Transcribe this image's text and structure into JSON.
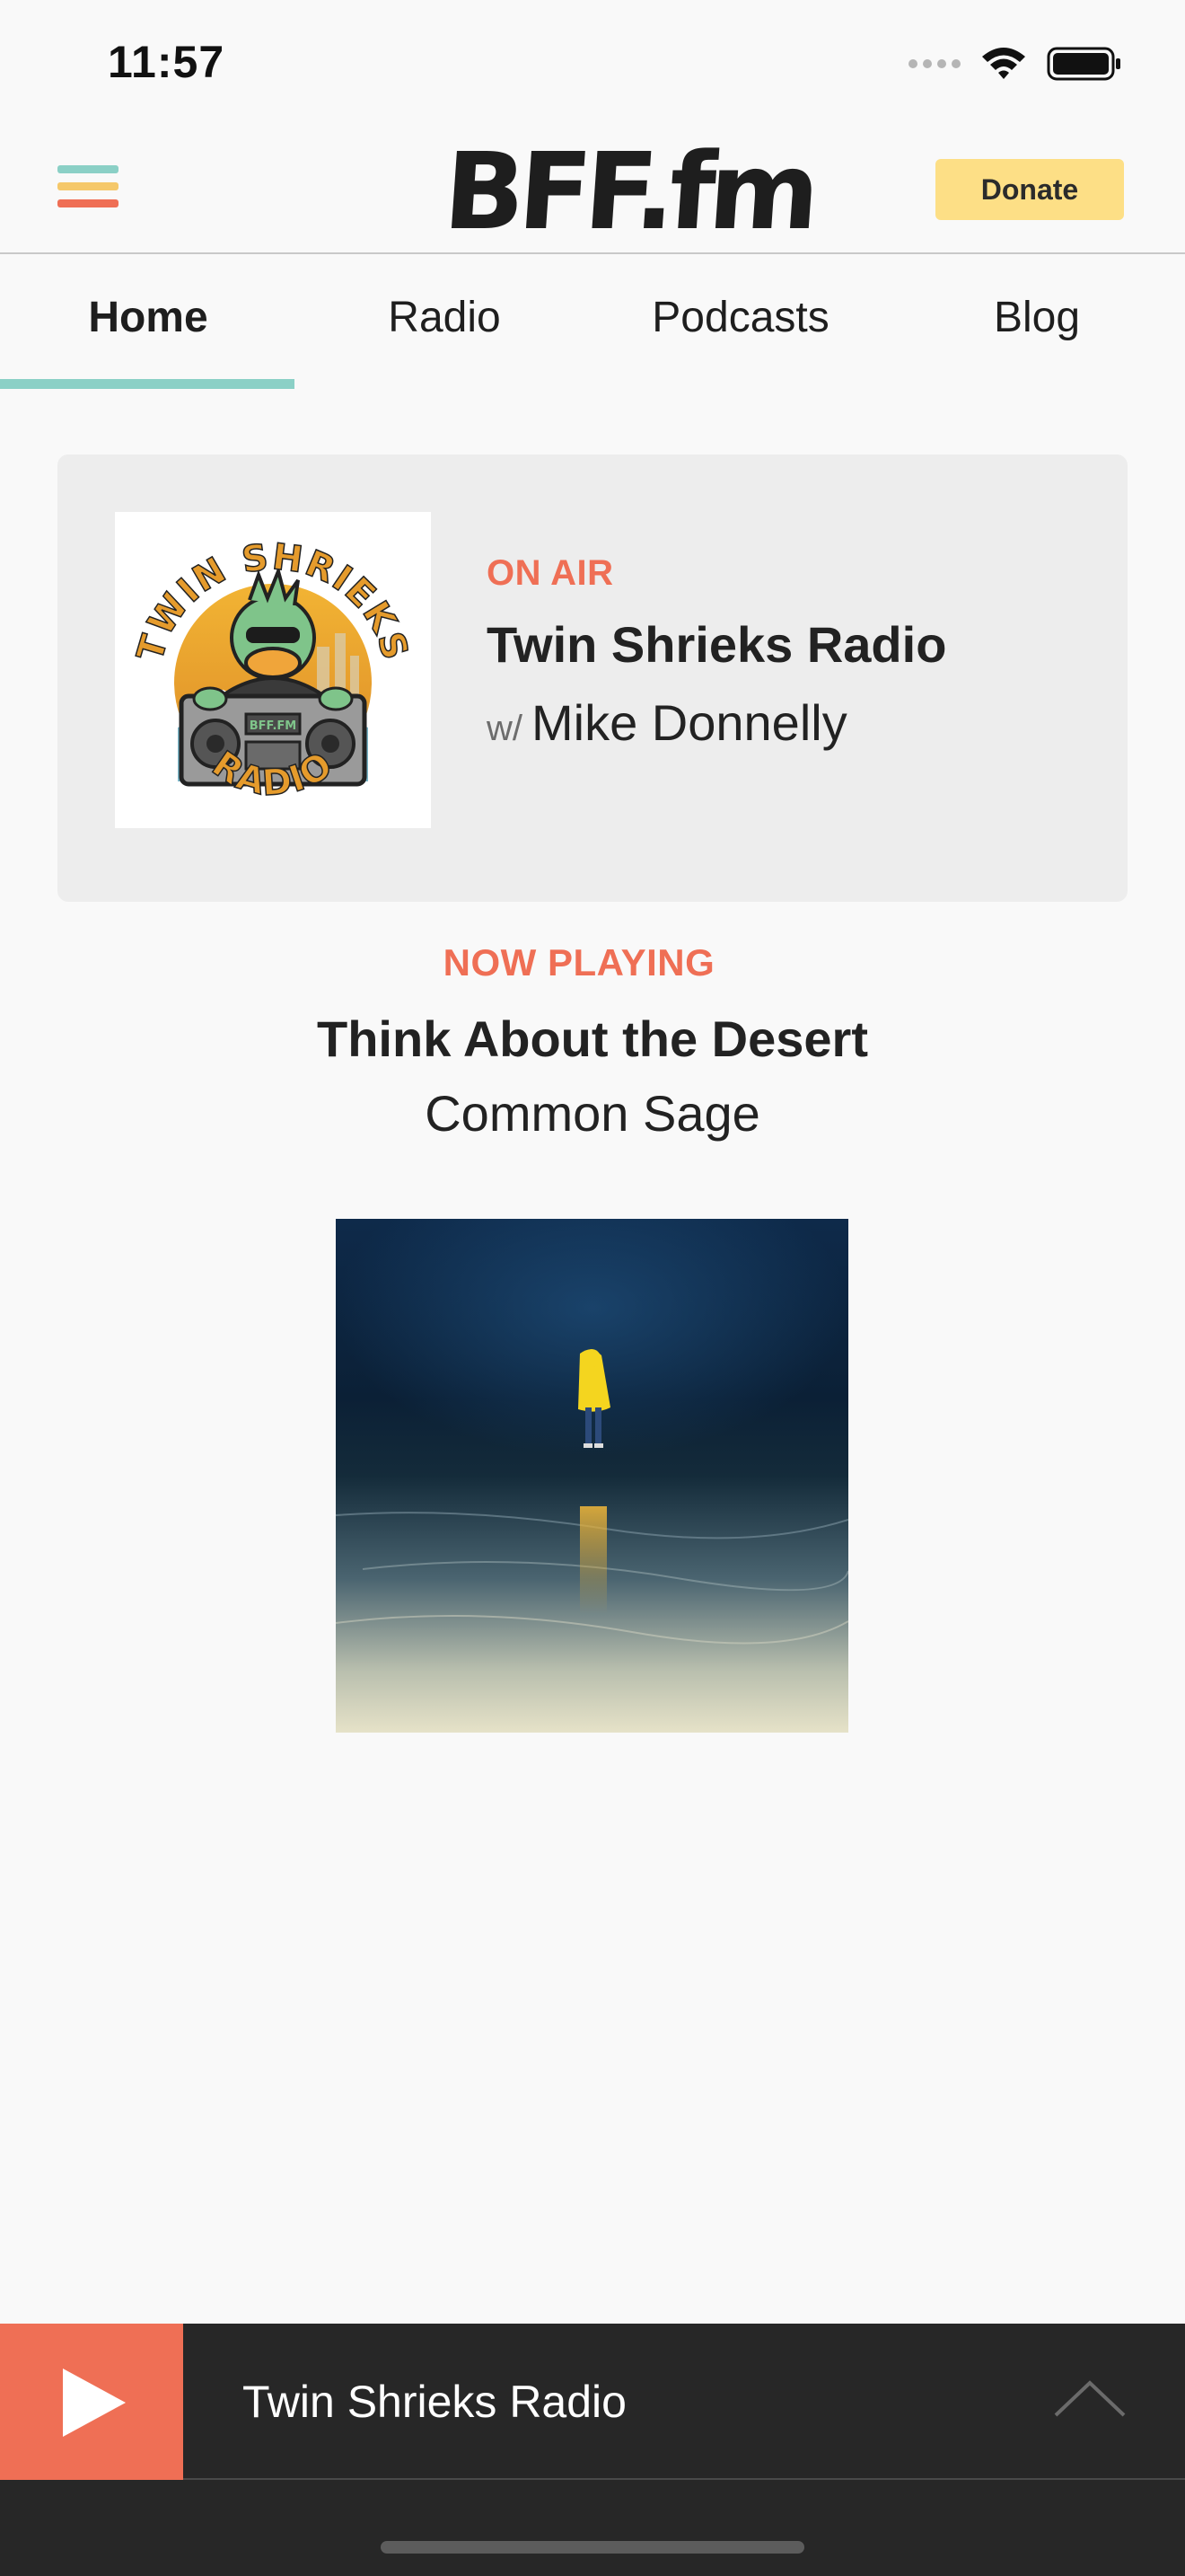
{
  "status_bar": {
    "time": "11:57",
    "icons": [
      "signal-icon",
      "wifi-icon",
      "battery-icon"
    ]
  },
  "header": {
    "logo_text": "BFF.fm",
    "donate_label": "Donate",
    "menu_icon": "hamburger-menu-icon"
  },
  "tabs": [
    {
      "label": "Home",
      "active": true
    },
    {
      "label": "Radio",
      "active": false
    },
    {
      "label": "Podcasts",
      "active": false
    },
    {
      "label": "Blog",
      "active": false
    }
  ],
  "on_air": {
    "label": "ON AIR",
    "show_title": "Twin Shrieks Radio",
    "host_prefix": "w/",
    "host_name": "Mike Donnelly",
    "artwork": {
      "top_text": "TWIN SHRIEKS",
      "bottom_text": "RADIO",
      "boombox_text": "BFF.FM"
    }
  },
  "now_playing": {
    "label": "NOW PLAYING",
    "track_title": "Think About the Desert",
    "artist": "Common Sage"
  },
  "player": {
    "title": "Twin Shrieks Radio",
    "play_icon": "play-icon",
    "expand_icon": "chevron-up-icon"
  },
  "colors": {
    "accent_orange": "#ef6f55",
    "accent_teal": "#8bd0c6",
    "accent_yellow": "#f5c86a",
    "donate_bg": "#fddf86",
    "player_bg": "#272727"
  }
}
